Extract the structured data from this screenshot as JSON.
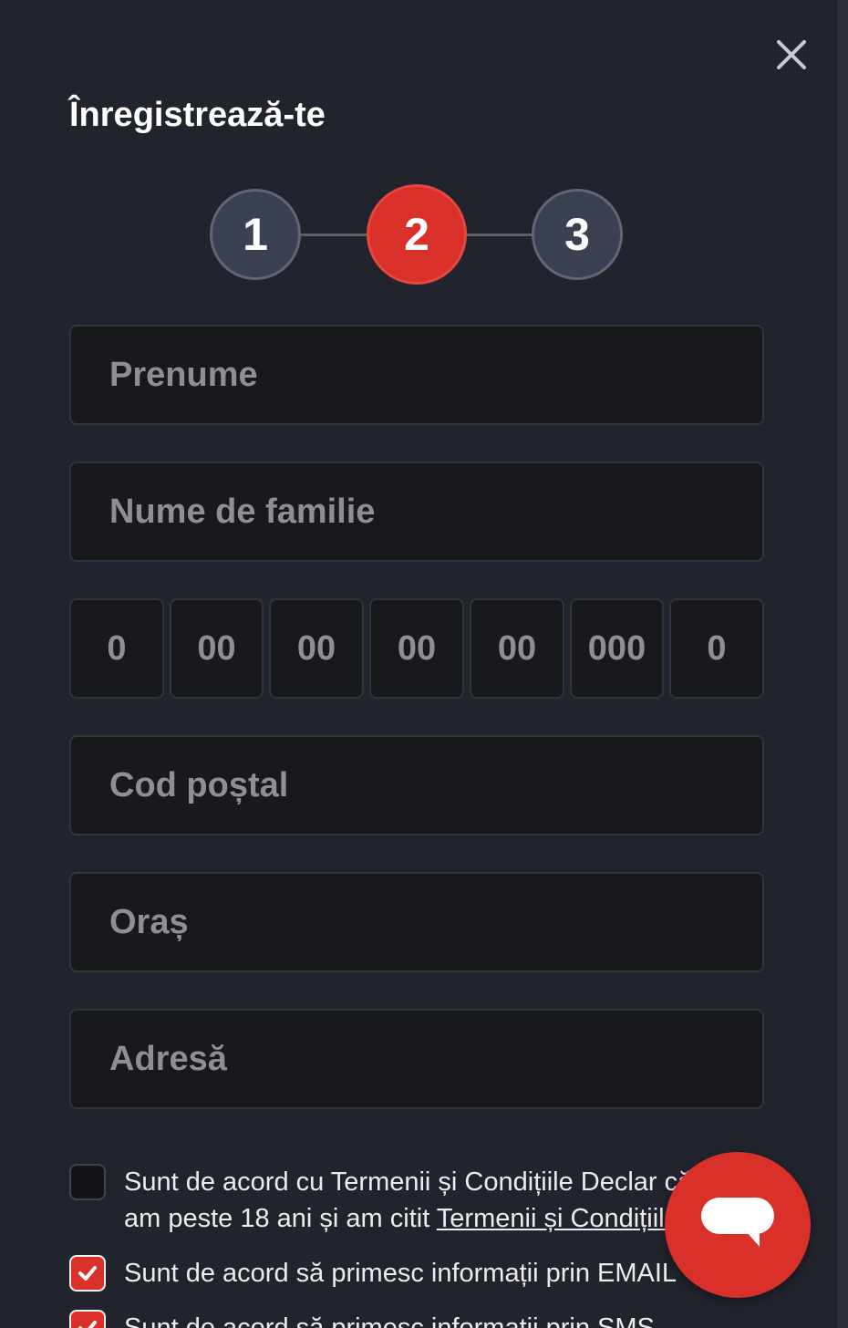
{
  "modal": {
    "title": "Înregistrează-te",
    "close_icon": "close-icon"
  },
  "stepper": {
    "steps": [
      {
        "label": "1",
        "state": "completed"
      },
      {
        "label": "2",
        "state": "active"
      },
      {
        "label": "3",
        "state": "upcoming"
      }
    ],
    "active_color": "#d9302a",
    "inactive_color": "#3b4150"
  },
  "form": {
    "first_name": {
      "placeholder": "Prenume",
      "value": ""
    },
    "last_name": {
      "placeholder": "Nume de familie",
      "value": ""
    },
    "phone_segments": [
      "0",
      "00",
      "00",
      "00",
      "00",
      "000",
      "0"
    ],
    "postal_code": {
      "placeholder": "Cod poștal",
      "value": ""
    },
    "city": {
      "placeholder": "Oraș",
      "value": ""
    },
    "address": {
      "placeholder": "Adresă",
      "value": ""
    }
  },
  "consents": [
    {
      "checked": false,
      "line1": "Sunt de acord cu Termenii și Condițiile Declar că",
      "line2_prefix": "am peste 18 ani și am citit ",
      "line2_link": "Termenii și Condițiile"
    },
    {
      "checked": true,
      "text": "Sunt de acord să primesc informații prin EMAIL"
    },
    {
      "checked": true,
      "text": "Sunt de acord să primesc informații prin SMS"
    }
  ],
  "chat": {
    "icon": "chat-bubble-icon",
    "color": "#d9302a"
  }
}
